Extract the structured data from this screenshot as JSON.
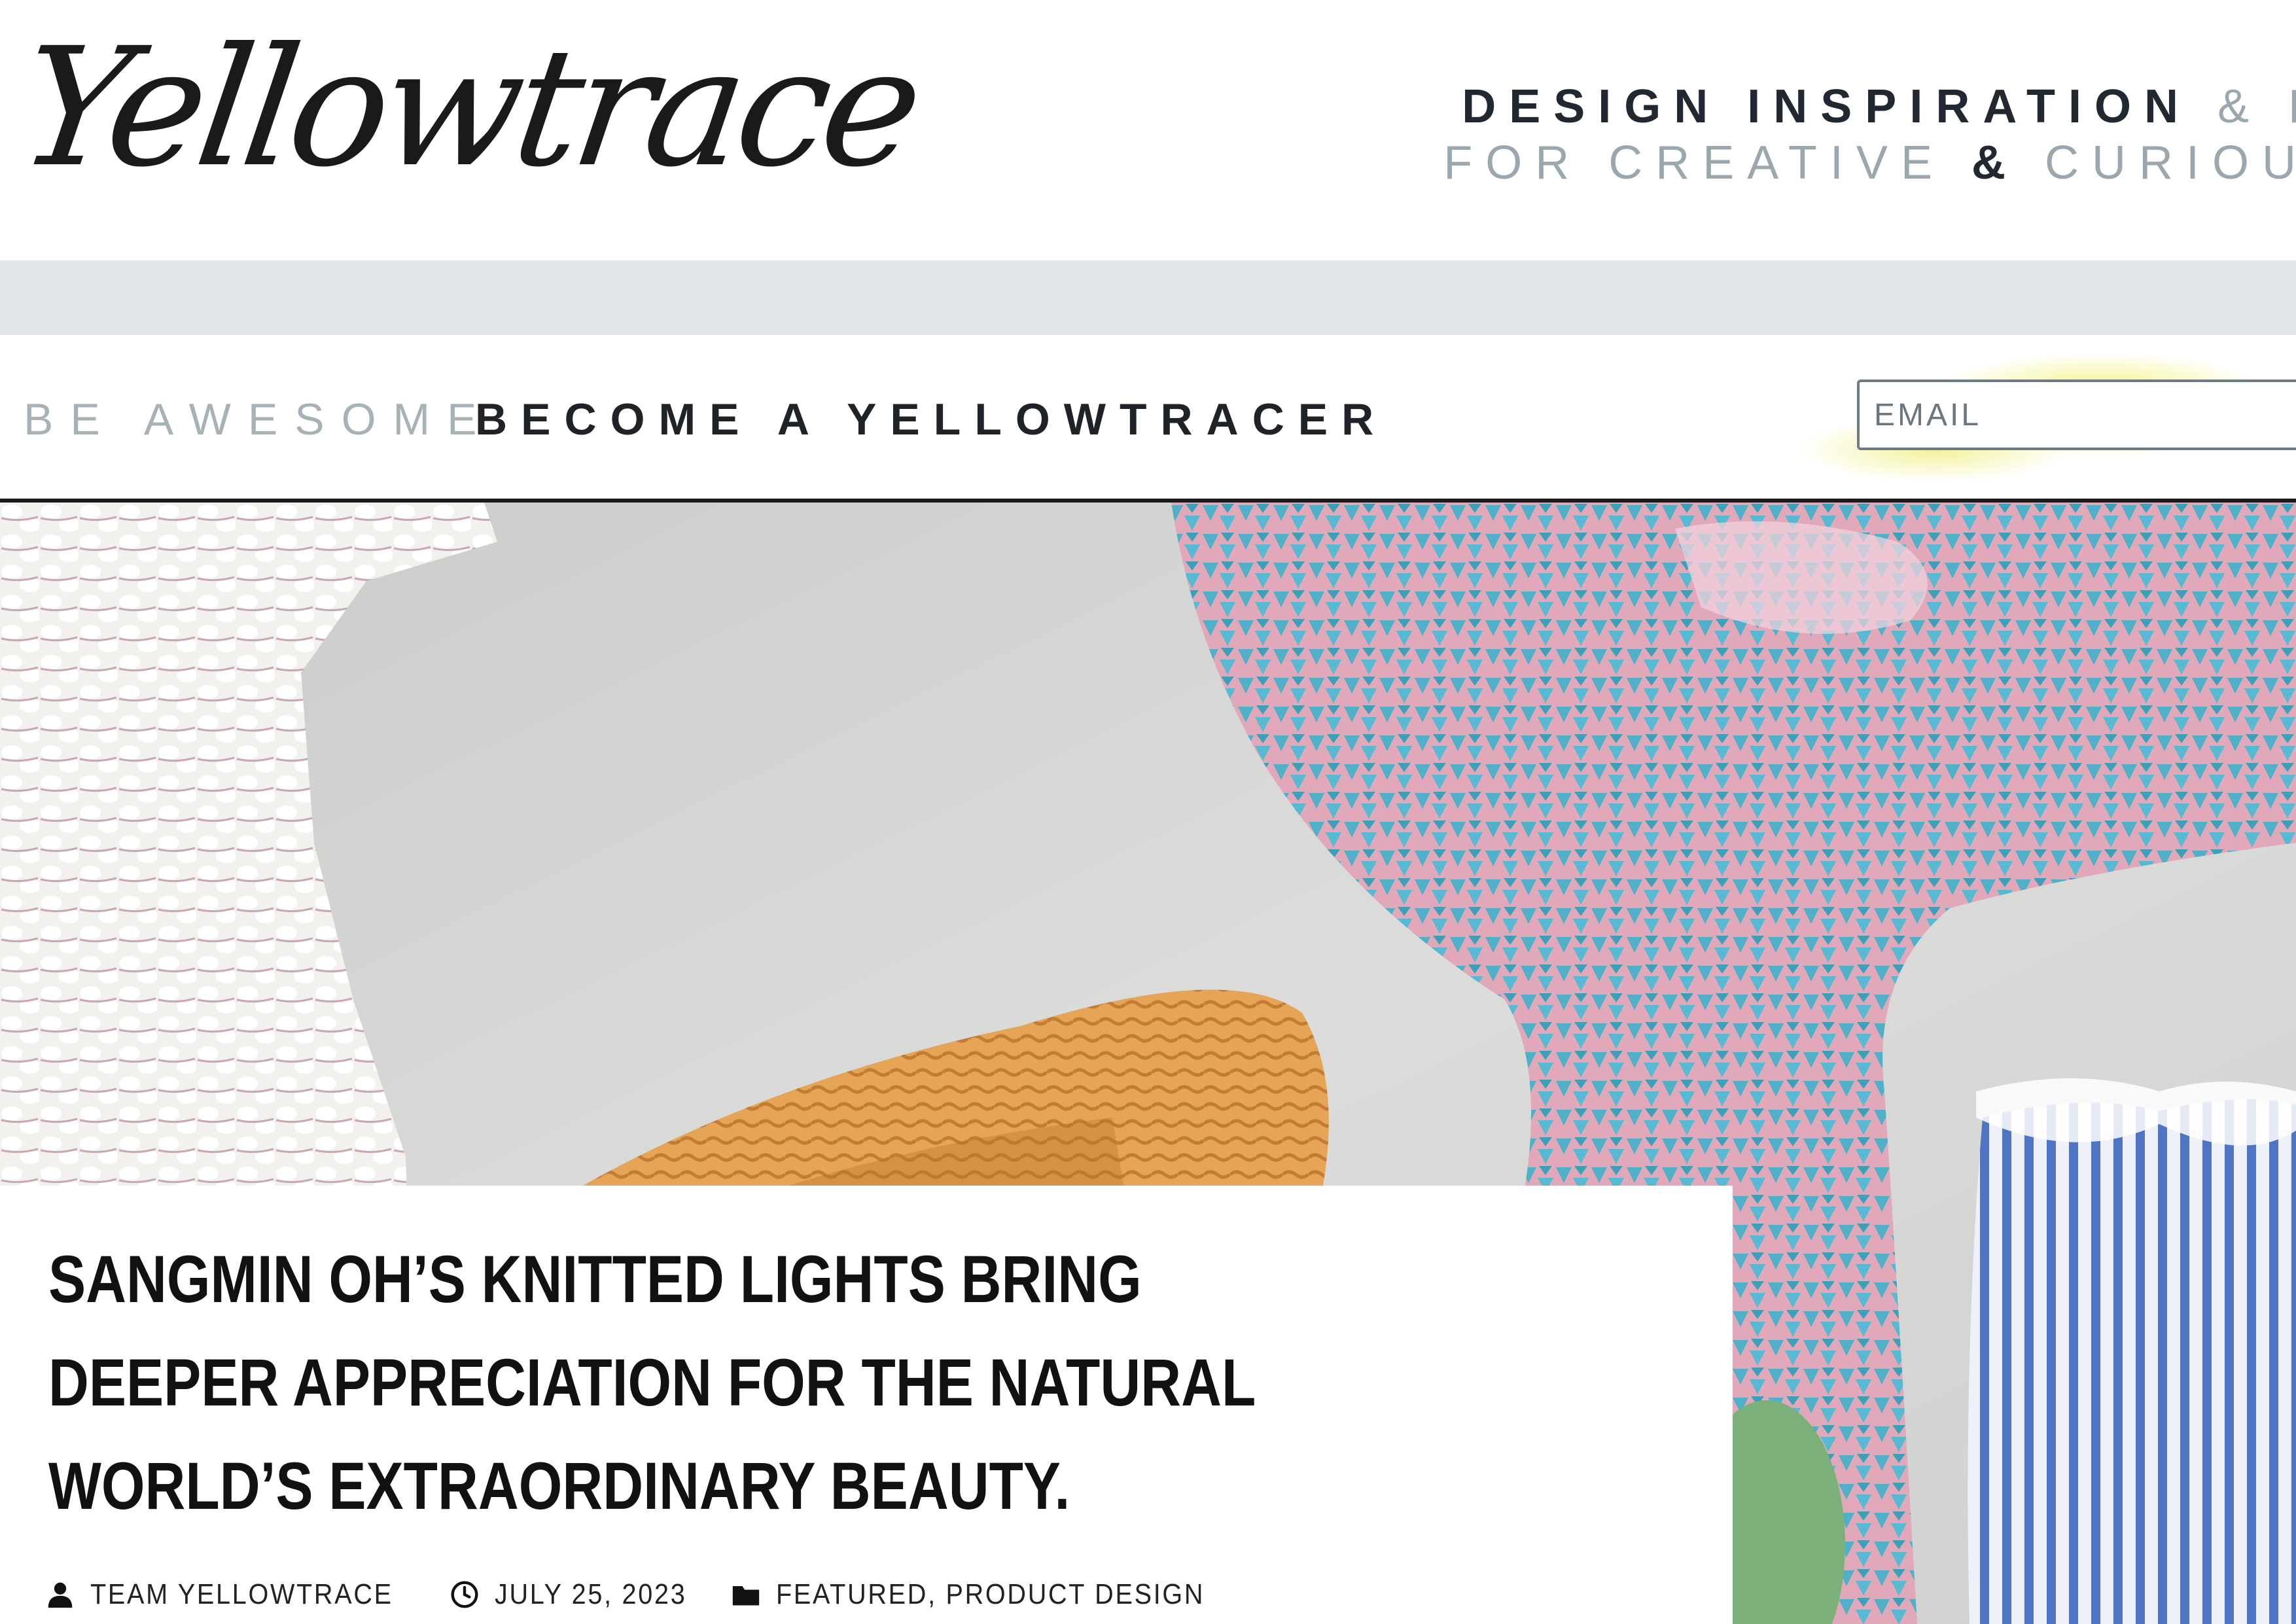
{
  "header": {
    "logo_text": "Yellowtrace",
    "tagline_line1_dark": "DESIGN INSPIRATION",
    "tagline_line1_light": "& R",
    "tagline_line2_light_a": "FOR CREATIVE",
    "tagline_line2_dark": "&",
    "tagline_line2_light_b": "CURIOU"
  },
  "subscribe": {
    "be_awesome": "BE AWESOME",
    "become": "BECOME A YELLOWTRACER",
    "email_placeholder": "EMAIL"
  },
  "article": {
    "title": "SANGMIN OH’S KNITTED LIGHTS BRING DEEPER APPRECIATION FOR THE NATURAL WORLD’S EXTRAORDINARY BEAUTY.",
    "author": "TEAM YELLOWTRACE",
    "date": "JULY 25, 2023",
    "categories": [
      "FEATURED",
      "PRODUCT DESIGN"
    ],
    "category_separator": ","
  },
  "icons": {
    "author": "user-icon",
    "date": "clock-icon",
    "categories": "folder-icon"
  },
  "colors": {
    "accent_yellow": "#f0ee50",
    "nav_strip": "#e2e8ea",
    "text_dark": "#1f2328",
    "text_light": "#9aa8ae"
  }
}
